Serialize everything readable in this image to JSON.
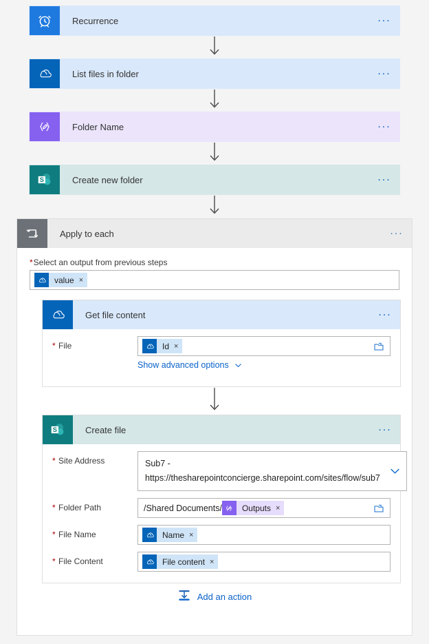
{
  "flow": {
    "top_steps": [
      {
        "id": "recurrence",
        "label": "Recurrence",
        "icon": "alarm-clock-icon",
        "icon_class": "ic-recur",
        "tint": "tint-blue",
        "menu": "..."
      },
      {
        "id": "list-files",
        "label": "List files in folder",
        "icon": "onedrive-icon",
        "icon_class": "ic-od",
        "tint": "tint-blue",
        "menu": "..."
      },
      {
        "id": "folder-name",
        "label": "Folder Name",
        "icon": "compose-icon",
        "icon_class": "ic-comp",
        "tint": "tint-purple",
        "menu": "..."
      },
      {
        "id": "create-new-folder",
        "label": "Create new folder",
        "icon": "sharepoint-icon",
        "icon_class": "ic-sp",
        "tint": "tint-teal",
        "menu": "..."
      }
    ],
    "loop": {
      "title": "Apply to each",
      "icon": "loop-icon",
      "menu": "...",
      "output_field": {
        "label": "Select an output from previous steps",
        "required_marker": "*",
        "token": {
          "text": "value",
          "icon": "onedrive-icon",
          "remove": "×"
        }
      },
      "actions": [
        {
          "id": "get-file-content",
          "title": "Get file content",
          "icon": "onedrive-icon",
          "icon_class": "ic-od",
          "tint": "tint-blue",
          "menu": "...",
          "fields": [
            {
              "id": "file",
              "label": "File",
              "required_marker": "*",
              "token": {
                "text": "Id",
                "icon": "onedrive-icon",
                "remove": "×"
              },
              "trailing_icon": "folder-picker-icon"
            }
          ],
          "advanced_link": "Show advanced options"
        },
        {
          "id": "create-file",
          "title": "Create file",
          "icon": "sharepoint-icon",
          "icon_class": "ic-sp",
          "tint": "tint-teal",
          "menu": "...",
          "fields": [
            {
              "id": "site-address",
              "label": "Site Address",
              "required_marker": "*",
              "value": "Sub7 - https://thesharepointconcierge.sharepoint.com/sites/flow/sub7",
              "trailing_icon": "chevron-down-icon"
            },
            {
              "id": "folder-path",
              "label": "Folder Path",
              "required_marker": "*",
              "prefix_text": "/Shared Documents/",
              "token": {
                "text": "Outputs",
                "icon": "compose-icon",
                "remove": "×"
              },
              "trailing_icon": "folder-picker-icon"
            },
            {
              "id": "file-name",
              "label": "File Name",
              "required_marker": "*",
              "token": {
                "text": "Name",
                "icon": "onedrive-icon",
                "remove": "×"
              }
            },
            {
              "id": "file-content",
              "label": "File Content",
              "required_marker": "*",
              "token": {
                "text": "File content",
                "icon": "onedrive-icon",
                "remove": "×"
              }
            }
          ]
        }
      ],
      "add_action": {
        "label": "Add an action",
        "icon": "add-action-icon"
      }
    }
  },
  "colors": {
    "link": "#0a62c9",
    "required": "#a80000",
    "recurrence_icon": "#1f7ae0",
    "onedrive_icon": "#0364b8",
    "compose_icon": "#8661f0",
    "sharepoint_icon": "#0f7d80",
    "loop_icon": "#6c7177",
    "card_blue": "#d9e8fa",
    "card_purple": "#ebe4fb",
    "card_teal": "#d6e7e7",
    "card_gray": "#ebebeb"
  }
}
